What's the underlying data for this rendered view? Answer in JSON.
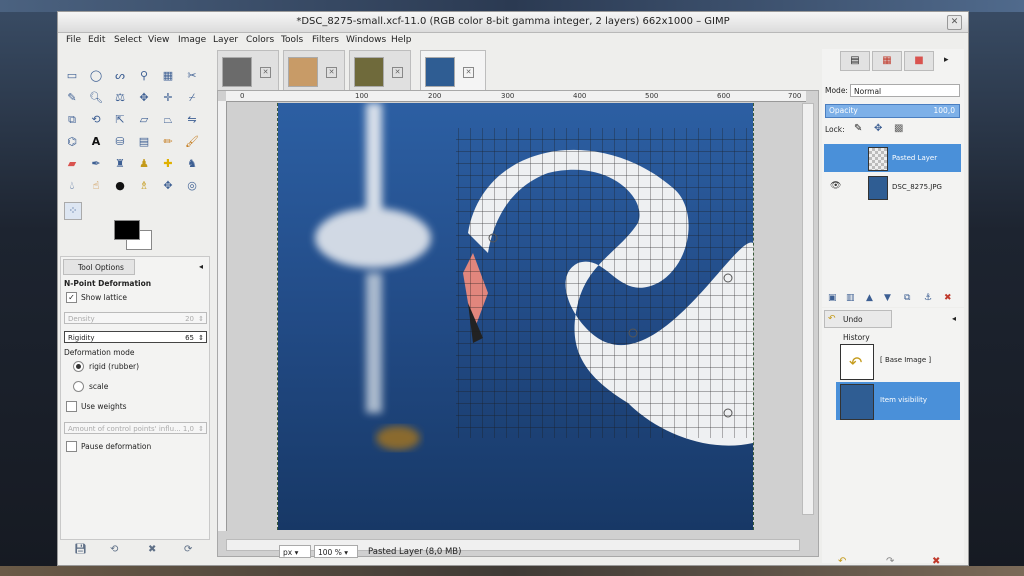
{
  "window": {
    "title": "*DSC_8275-small.xcf-11.0 (RGB color 8-bit gamma integer, 2 layers) 662x1000 – GIMP",
    "close_glyph": "✕"
  },
  "menu": [
    "File",
    "Edit",
    "Select",
    "View",
    "Image",
    "Layer",
    "Colors",
    "Tools",
    "Filters",
    "Windows",
    "Help"
  ],
  "toolbox": {
    "icons": [
      "rect-select-icon",
      "ellipse-select-icon",
      "free-select-icon",
      "fuzzy-select-icon",
      "color-select-icon",
      "color-picker-icon",
      "zoom-icon",
      "measure-icon",
      "move-icon",
      "align-icon",
      "crop-icon",
      "unified-transform-icon",
      "rotate-icon",
      "scale-icon",
      "shear-icon",
      "perspective-icon",
      "text-icon",
      "bucket-fill-icon",
      "blend-icon",
      "pencil-icon",
      "eraser-icon",
      "airbrush-icon",
      "ink-icon",
      "clone-icon",
      "heal-icon",
      "smudge-icon",
      "dodge-icon",
      "paths-icon",
      "npoint-icon",
      "warp-icon",
      "cage-icon"
    ],
    "fg_color": "#000000",
    "bg_color": "#ffffff"
  },
  "tool_options": {
    "tab_label": "Tool Options",
    "tool_name": "N-Point Deformation",
    "show_lattice": "Show lattice",
    "density_label": "Density",
    "density_value": "20",
    "rigidity_label": "Rigidity",
    "rigidity_value": "65",
    "deformation_mode": "Deformation mode",
    "mode_rigid": "rigid (rubber)",
    "mode_scale": "scale",
    "use_weights": "Use weights",
    "amount_label": "Amount of control points' influ...",
    "amount_value": "1,0",
    "pause_deformation": "Pause deformation"
  },
  "image_tabs": [
    {
      "name": "image-tab-1",
      "color": "#6b6b6b"
    },
    {
      "name": "image-tab-2",
      "color": "#c89b67"
    },
    {
      "name": "image-tab-3",
      "color": "#6f6a3b"
    },
    {
      "name": "image-tab-4",
      "color": "#2f5d93"
    }
  ],
  "rulers": [
    "0",
    "100",
    "200",
    "300",
    "400",
    "500",
    "600",
    "700"
  ],
  "statusbar": {
    "unit": "px",
    "zoom": "100 %",
    "status": "Pasted Layer (8,0 MB)"
  },
  "layers": {
    "mode_label": "Mode:",
    "mode_value": "Normal",
    "opacity_label": "Opacity",
    "opacity_value": "100,0",
    "lock_label": "Lock:",
    "items": [
      {
        "name": "Pasted Layer",
        "selected": true
      },
      {
        "name": "DSC_8275.JPG",
        "selected": false
      }
    ]
  },
  "undo": {
    "tab_label": "Undo History",
    "items": [
      {
        "name": "[ Base Image ]",
        "selected": false
      },
      {
        "name": "Item visibility",
        "selected": true
      }
    ]
  }
}
